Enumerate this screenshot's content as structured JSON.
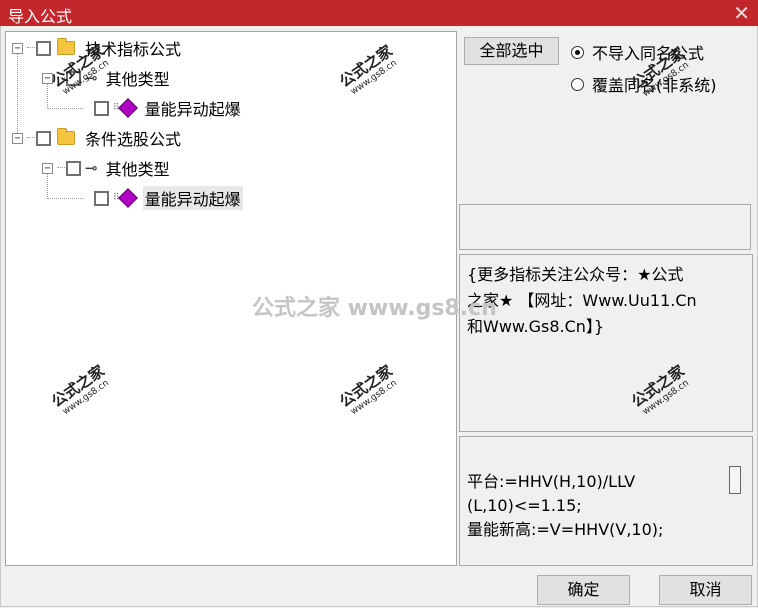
{
  "window": {
    "title": "导入公式",
    "close_glyph": "✕"
  },
  "tree": [
    {
      "label": "技术指标公式",
      "icon": "folder-icon"
    },
    {
      "label": "其他类型",
      "icon": "key-icon"
    },
    {
      "label": "量能异动起爆",
      "icon": "gem-icon"
    },
    {
      "label": "条件选股公式",
      "icon": "folder-icon"
    },
    {
      "label": "其他类型",
      "icon": "key-icon"
    },
    {
      "label": "量能异动起爆",
      "icon": "gem-icon",
      "selected": true
    }
  ],
  "expander_glyph": "−",
  "controls": {
    "select_all_label": "全部选中",
    "radio_no_import_label": "不导入同名公式",
    "radio_overwrite_label": "覆盖同名(非系统)",
    "selected_option": "不导入同名公式"
  },
  "description_lines": [
    "{更多指标关注公众号：★公式",
    "之家★ 【网址：Www.Uu11.Cn",
    "和Www.Gs8.Cn】}"
  ],
  "code_lines": [
    "平台:=HHV(H,10)/LLV",
    "(L,10)<=1.15;",
    "量能新高:=V=HHV(V,10);"
  ],
  "buttons": {
    "ok_label": "确定",
    "cancel_label": "取消"
  },
  "watermark": {
    "stamp_cn": "公式之家",
    "stamp_url": "www.gs8.cn",
    "center_text": "公式之家 www.gs8.cn"
  },
  "colors": {
    "titlebar": "#c1272d",
    "folder": "#f5c542",
    "gem": "#b000c8"
  }
}
